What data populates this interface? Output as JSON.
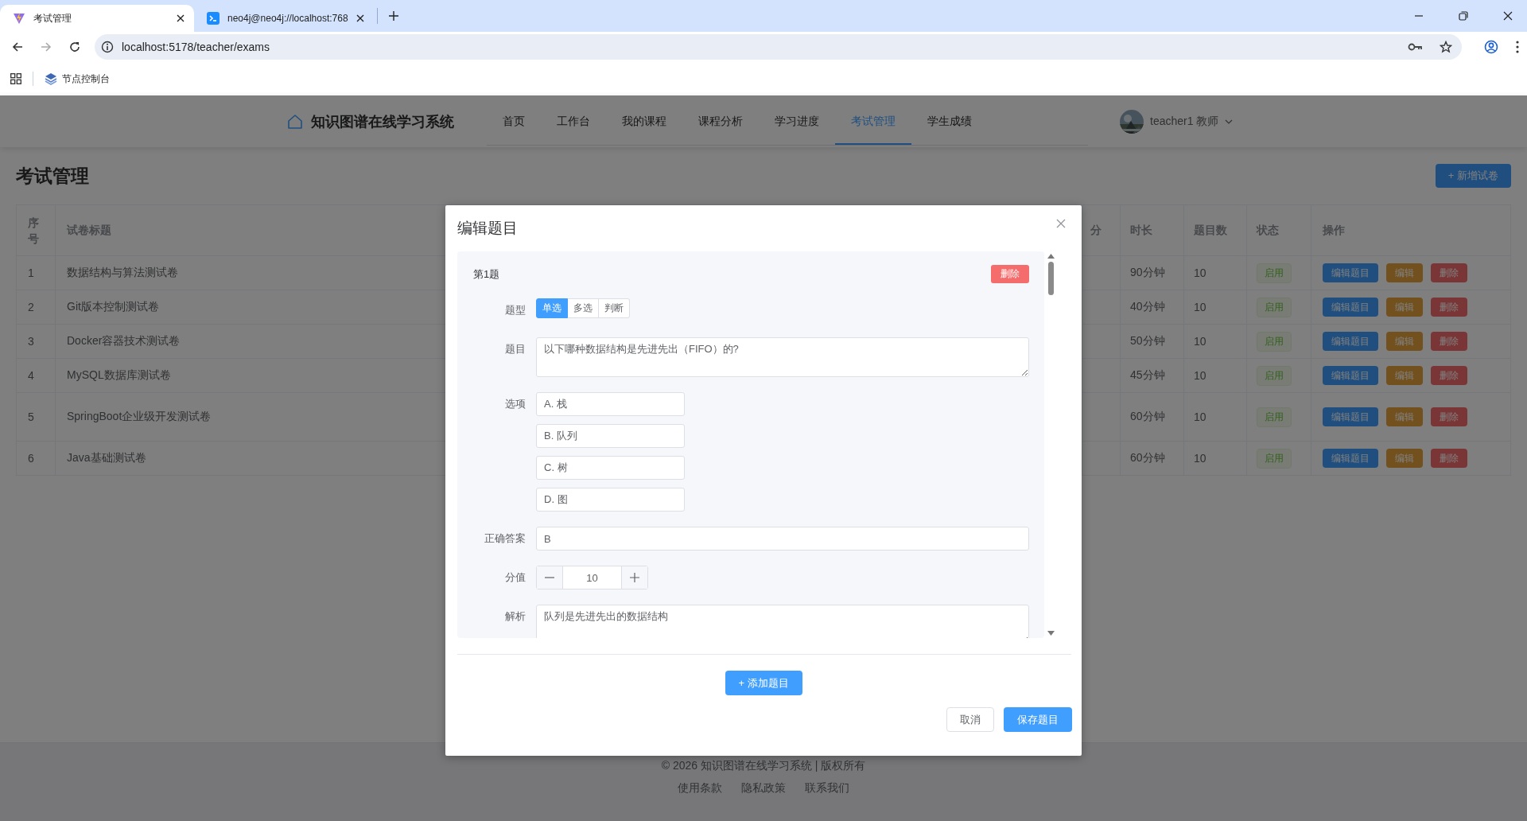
{
  "browser": {
    "tabs": [
      {
        "title": "考试管理",
        "selected": true,
        "kind": "vite"
      },
      {
        "title": "neo4j@neo4j://localhost:768",
        "selected": false,
        "kind": "terminal"
      }
    ],
    "url": "localhost:5178/teacher/exams",
    "bookmarks": [
      {
        "label": "节点控制台"
      }
    ]
  },
  "header": {
    "logo": "知识图谱在线学习系统",
    "nav": [
      {
        "label": "首页",
        "selected": false
      },
      {
        "label": "工作台",
        "selected": false
      },
      {
        "label": "我的课程",
        "selected": false
      },
      {
        "label": "课程分析",
        "selected": false
      },
      {
        "label": "学习进度",
        "selected": false
      },
      {
        "label": "考试管理",
        "selected": true
      },
      {
        "label": "学生成绩",
        "selected": false
      }
    ],
    "user": "teacher1 教师"
  },
  "page": {
    "title": "考试管理",
    "new_button": "+ 新增试卷"
  },
  "table": {
    "columns": [
      "序号",
      "试卷标题",
      "分",
      "时长",
      "题目数",
      "状态",
      "操作"
    ],
    "rows": [
      {
        "index": "1",
        "title": "数据结构与算法测试卷",
        "duration": "90分钟",
        "count": "10",
        "status": {
          "label": "启用",
          "kind": "success"
        },
        "actions": [
          {
            "label": "编辑题目",
            "kind": "primary"
          },
          {
            "label": "编辑",
            "kind": "warning"
          },
          {
            "label": "删除",
            "kind": "danger"
          }
        ]
      },
      {
        "index": "2",
        "title": "Git版本控制测试卷",
        "duration": "40分钟",
        "count": "10",
        "status": {
          "label": "启用",
          "kind": "success"
        },
        "actions": [
          {
            "label": "编辑题目",
            "kind": "primary"
          },
          {
            "label": "编辑",
            "kind": "warning"
          },
          {
            "label": "删除",
            "kind": "danger"
          }
        ]
      },
      {
        "index": "3",
        "title": "Docker容器技术测试卷",
        "duration": "50分钟",
        "count": "10",
        "status": {
          "label": "启用",
          "kind": "success"
        },
        "actions": [
          {
            "label": "编辑题目",
            "kind": "primary"
          },
          {
            "label": "编辑",
            "kind": "warning"
          },
          {
            "label": "删除",
            "kind": "danger"
          }
        ]
      },
      {
        "index": "4",
        "title": "MySQL数据库测试卷",
        "duration": "45分钟",
        "count": "10",
        "status": {
          "label": "启用",
          "kind": "success"
        },
        "actions": [
          {
            "label": "编辑题目",
            "kind": "primary"
          },
          {
            "label": "编辑",
            "kind": "warning"
          },
          {
            "label": "删除",
            "kind": "danger"
          }
        ]
      },
      {
        "index": "5",
        "title": "SpringBoot企业级开发测试卷",
        "duration": "60分钟",
        "count": "10",
        "status": {
          "label": "启用",
          "kind": "success"
        },
        "actions": [
          {
            "label": "编辑题目",
            "kind": "primary"
          },
          {
            "label": "编辑",
            "kind": "warning"
          },
          {
            "label": "删除",
            "kind": "danger"
          }
        ]
      },
      {
        "index": "6",
        "title": "Java基础测试卷",
        "duration": "60分钟",
        "count": "10",
        "status": {
          "label": "启用",
          "kind": "success"
        },
        "actions": [
          {
            "label": "编辑题目",
            "kind": "primary"
          },
          {
            "label": "编辑",
            "kind": "warning"
          },
          {
            "label": "删除",
            "kind": "danger"
          }
        ]
      }
    ]
  },
  "modal": {
    "title": "编辑题目",
    "questions": [
      {
        "heading": "第1题",
        "delete": {
          "label": "删除",
          "kind": "danger"
        },
        "fields": [
          {
            "kind": "types",
            "label": "题型",
            "options": [
              {
                "label": "单选",
                "selected": true
              },
              {
                "label": "多选",
                "selected": false
              },
              {
                "label": "判断",
                "selected": false
              }
            ]
          },
          {
            "kind": "textarea",
            "label": "题目",
            "value": "以下哪种数据结构是先进先出（FIFO）的?"
          },
          {
            "kind": "options",
            "label": "选项",
            "values": [
              "A. 栈",
              "B. 队列",
              "C. 树",
              "D. 图"
            ]
          },
          {
            "kind": "input",
            "label": "正确答案",
            "value": "B"
          },
          {
            "kind": "number",
            "label": "分值",
            "value": "10"
          },
          {
            "kind": "textarea",
            "label": "解析",
            "value": "队列是先进先出的数据结构"
          }
        ]
      }
    ],
    "add_button": "+ 添加题目",
    "buttons": [
      {
        "label": "取消",
        "kind": "default"
      },
      {
        "label": "保存题目",
        "kind": "primary"
      }
    ]
  },
  "footer": {
    "copyright": "© 2026 知识图谱在线学习系统 | 版权所有",
    "links": [
      "使用条款",
      "隐私政策",
      "联系我们"
    ]
  }
}
